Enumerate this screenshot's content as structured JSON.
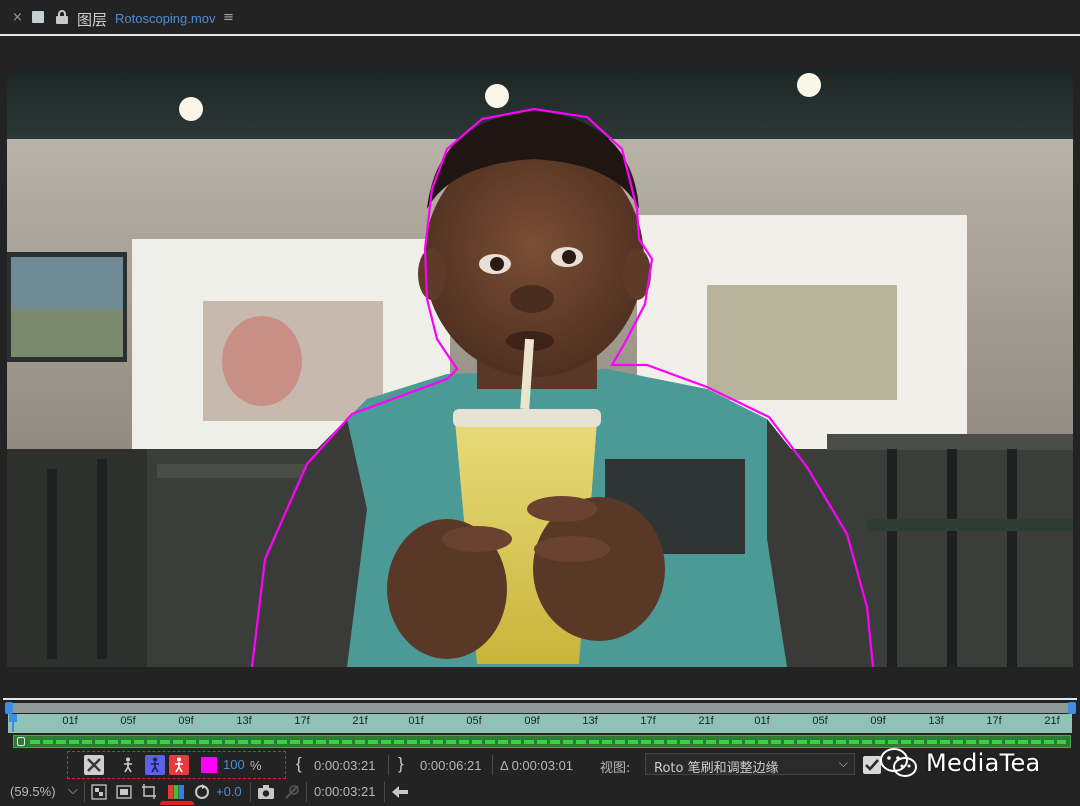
{
  "panel": {
    "close_icon": "×",
    "title": "图层",
    "file": "Rotoscoping.mov",
    "menu_icon": "≡"
  },
  "timeline": {
    "ticks": [
      "01f",
      "05f",
      "09f",
      "13f",
      "17f",
      "21f",
      "01f",
      "05f",
      "09f",
      "13f",
      "17f",
      "21f",
      "01f",
      "05f",
      "09f",
      "13f",
      "17f",
      "21f"
    ]
  },
  "roto_controls": {
    "opacity_value": "100",
    "opacity_unit": "%",
    "in_time": "0:00:03:21",
    "out_time": "0:00:06:21",
    "duration": "Δ 0:00:03:01",
    "view_label": "视图:",
    "view_value": "Roto 笔刷和调整边缘",
    "colors": {
      "matte": "#ff00ff",
      "accent_blue": "#3d8ee0",
      "selection": "#e02020",
      "track": "#36d63b"
    }
  },
  "bottom_bar": {
    "zoom": "(59.5%)",
    "exposure": "+0.0",
    "timecode": "0:00:03:21"
  },
  "watermark": {
    "text": "MediaTea"
  }
}
